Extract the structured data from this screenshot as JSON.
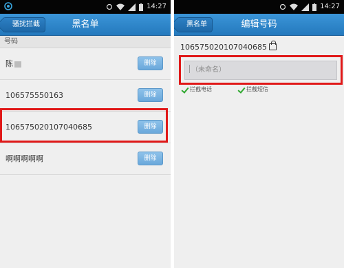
{
  "status": {
    "time": "14:27"
  },
  "left": {
    "back_label": "骚扰拦截",
    "title": "黑名单",
    "section_header": "号码",
    "delete_label": "删除",
    "rows": [
      {
        "number": "陈"
      },
      {
        "number": "106575550163"
      },
      {
        "number": "106575020107040685"
      },
      {
        "number": "啊啊啊啊啊"
      }
    ]
  },
  "right": {
    "back_label": "黑名单",
    "title": "编辑号码",
    "number": "106575020107040685",
    "name_placeholder": "（未命名）",
    "options": [
      {
        "label": "拦截电话",
        "checked": true
      },
      {
        "label": "拦截短信",
        "checked": true
      }
    ]
  },
  "colors": {
    "titlebar": "#2f87cc",
    "delete_button": "#7bb5e3",
    "highlight": "#e01818",
    "check": "#2fa82f"
  }
}
